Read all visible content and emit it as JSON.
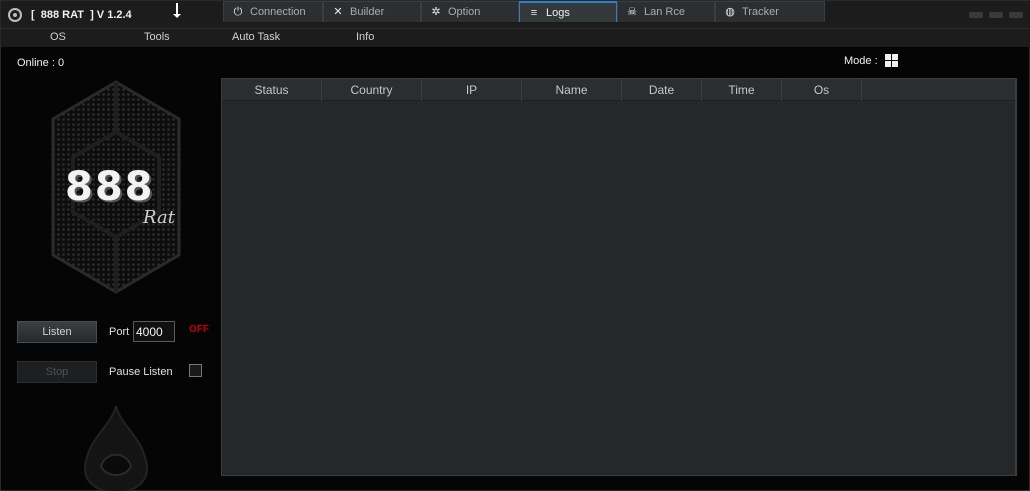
{
  "window": {
    "title": "[  888 RAT  ] V 1.2.4"
  },
  "menu": {
    "items": [
      "OS",
      "Tools",
      "Auto Task",
      "Info"
    ]
  },
  "left": {
    "online_label": "Online : 0",
    "logo_main": "888",
    "logo_sub": "Rat",
    "listen_button": "Listen",
    "stop_button": "Stop",
    "port_label": "Port",
    "port_value": "4000",
    "status": "OFF",
    "pause_label": "Pause Listen",
    "pause_checked": false
  },
  "tabs": [
    {
      "label": "Connection",
      "icon": "plug-icon",
      "active": false
    },
    {
      "label": "Builder",
      "icon": "tools-icon",
      "active": false
    },
    {
      "label": "Option",
      "icon": "gear-icon",
      "active": false
    },
    {
      "label": "Logs",
      "icon": "document-icon",
      "active": true
    },
    {
      "label": "Lan Rce",
      "icon": "skull-icon",
      "active": false
    },
    {
      "label": "Tracker",
      "icon": "globe-icon",
      "active": false
    }
  ],
  "mode": {
    "label": "Mode :",
    "icon": "windows-logo-icon"
  },
  "table": {
    "columns": [
      "Status",
      "Country",
      "IP",
      "Name",
      "Date",
      "Time",
      "Os"
    ]
  },
  "colors": {
    "accent": "#2f7fc0",
    "status_off": "#c00000",
    "panel": "#25282b"
  }
}
